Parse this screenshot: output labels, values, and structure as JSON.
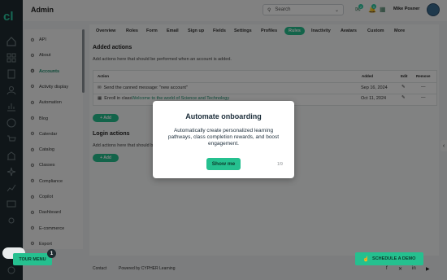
{
  "app": {
    "title": "Admin"
  },
  "search": {
    "label": "Search"
  },
  "topbar": {
    "badge_a": "2",
    "badge_b": "0",
    "user_name": "Mike Posner"
  },
  "tabs": [
    "Overview",
    "Roles",
    "Form",
    "Email",
    "Sign up",
    "Fields",
    "Settings",
    "Profiles",
    "Rules",
    "Inactivity",
    "Avatars",
    "Custom",
    "More"
  ],
  "active_tab": "Rules",
  "sidebar": {
    "items": [
      {
        "label": "API",
        "icon": "gear-icon"
      },
      {
        "label": "About",
        "icon": "gear-icon"
      },
      {
        "label": "Accounts",
        "icon": "gear-icon"
      },
      {
        "label": "Activity display",
        "icon": "gear-icon"
      },
      {
        "label": "Automation",
        "icon": "gear-icon"
      },
      {
        "label": "Blog",
        "icon": "gear-icon"
      },
      {
        "label": "Calendar",
        "icon": "gear-icon"
      },
      {
        "label": "Catalog",
        "icon": "gear-icon"
      },
      {
        "label": "Classes",
        "icon": "gear-icon"
      },
      {
        "label": "Compliance",
        "icon": "gear-icon"
      },
      {
        "label": "Copilot",
        "icon": "gear-icon"
      },
      {
        "label": "Dashboard",
        "icon": "gear-icon"
      },
      {
        "label": "E-commerce",
        "icon": "gear-icon"
      },
      {
        "label": "Export",
        "icon": "gear-icon"
      }
    ],
    "active": "Accounts"
  },
  "added_actions": {
    "title": "Added actions",
    "description": "Add actions here that should be performed when an account is added.",
    "columns": {
      "action": "Action",
      "added": "Added",
      "edit": "Edit",
      "remove": "Remove"
    },
    "rows": [
      {
        "icon": "envelope-icon",
        "text": "Send the canned message: \"new account\"",
        "link": "",
        "added": "Sep 16, 2024"
      },
      {
        "icon": "classroom-icon",
        "text": "Enroll in class ",
        "link": "Welcome to the world of Science and Technology",
        "added": "Oct 11, 2024"
      }
    ],
    "add_label": "+ Add"
  },
  "login_actions": {
    "title": "Login actions",
    "description": "Add actions here that should be",
    "add_label": "+ Add"
  },
  "footer": {
    "contact": "Contact",
    "powered": "Powered by CYPHER Learning"
  },
  "modal": {
    "title": "Automate onboarding",
    "body": "Automatically create personalized learning pathways, class completion rewards, and boost engagement.",
    "button": "Show me",
    "step": "1/9"
  },
  "tour_menu": {
    "label": "TOUR MENU",
    "badge": "1"
  },
  "schedule_demo": {
    "label": "SCHEDULE A DEMO"
  },
  "colors": {
    "accent": "#25c08f",
    "rail": "#1f2b30",
    "link": "#1e8f6e"
  }
}
